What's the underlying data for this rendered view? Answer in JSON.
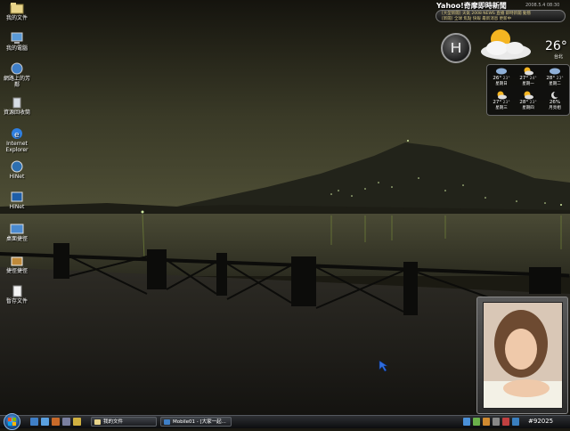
{
  "desktop": {
    "icons": [
      {
        "label": "我的文件"
      },
      {
        "label": "我的電腦"
      },
      {
        "label": "網路上的芳鄰"
      },
      {
        "label": "資源回收筒"
      },
      {
        "label": "Internet Explorer"
      },
      {
        "label": "HiNet"
      },
      {
        "label": "HiNet"
      },
      {
        "label": "桌面捷徑"
      },
      {
        "label": "捷徑捷徑"
      },
      {
        "label": "暫存文件"
      }
    ]
  },
  "yahoo_widget": {
    "title": "Yahoo!奇摩即時新聞",
    "date": "2008.5.4 08:30",
    "ticker_lines": [
      "[大型新聞] 天氣 2008 NEWS 直播 即時新聞 動態",
      "[新聞] 全球 焦點 快報 最新消息 更新中"
    ]
  },
  "weather_widget": {
    "temperature": "26°",
    "city": "台北",
    "forecast": [
      {
        "day": "星期日",
        "high": "26°",
        "low": "23°"
      },
      {
        "day": "星期一",
        "high": "27°",
        "low": "24°"
      },
      {
        "day": "星期二",
        "high": "28°",
        "low": "23°"
      },
      {
        "day": "星期三",
        "high": "27°",
        "low": "23°"
      },
      {
        "day": "星期四",
        "high": "28°",
        "low": "23°"
      },
      {
        "day": "月亮相",
        "high": "26%",
        "low": ""
      }
    ]
  },
  "taskbar": {
    "tasks": [
      {
        "label": "我的文件"
      },
      {
        "label": "Mobile01 - [大家一起..."
      }
    ],
    "clock": "#92025"
  },
  "colors": {
    "taskbar": "#1c1e22",
    "accent": "#1a4f8a"
  }
}
